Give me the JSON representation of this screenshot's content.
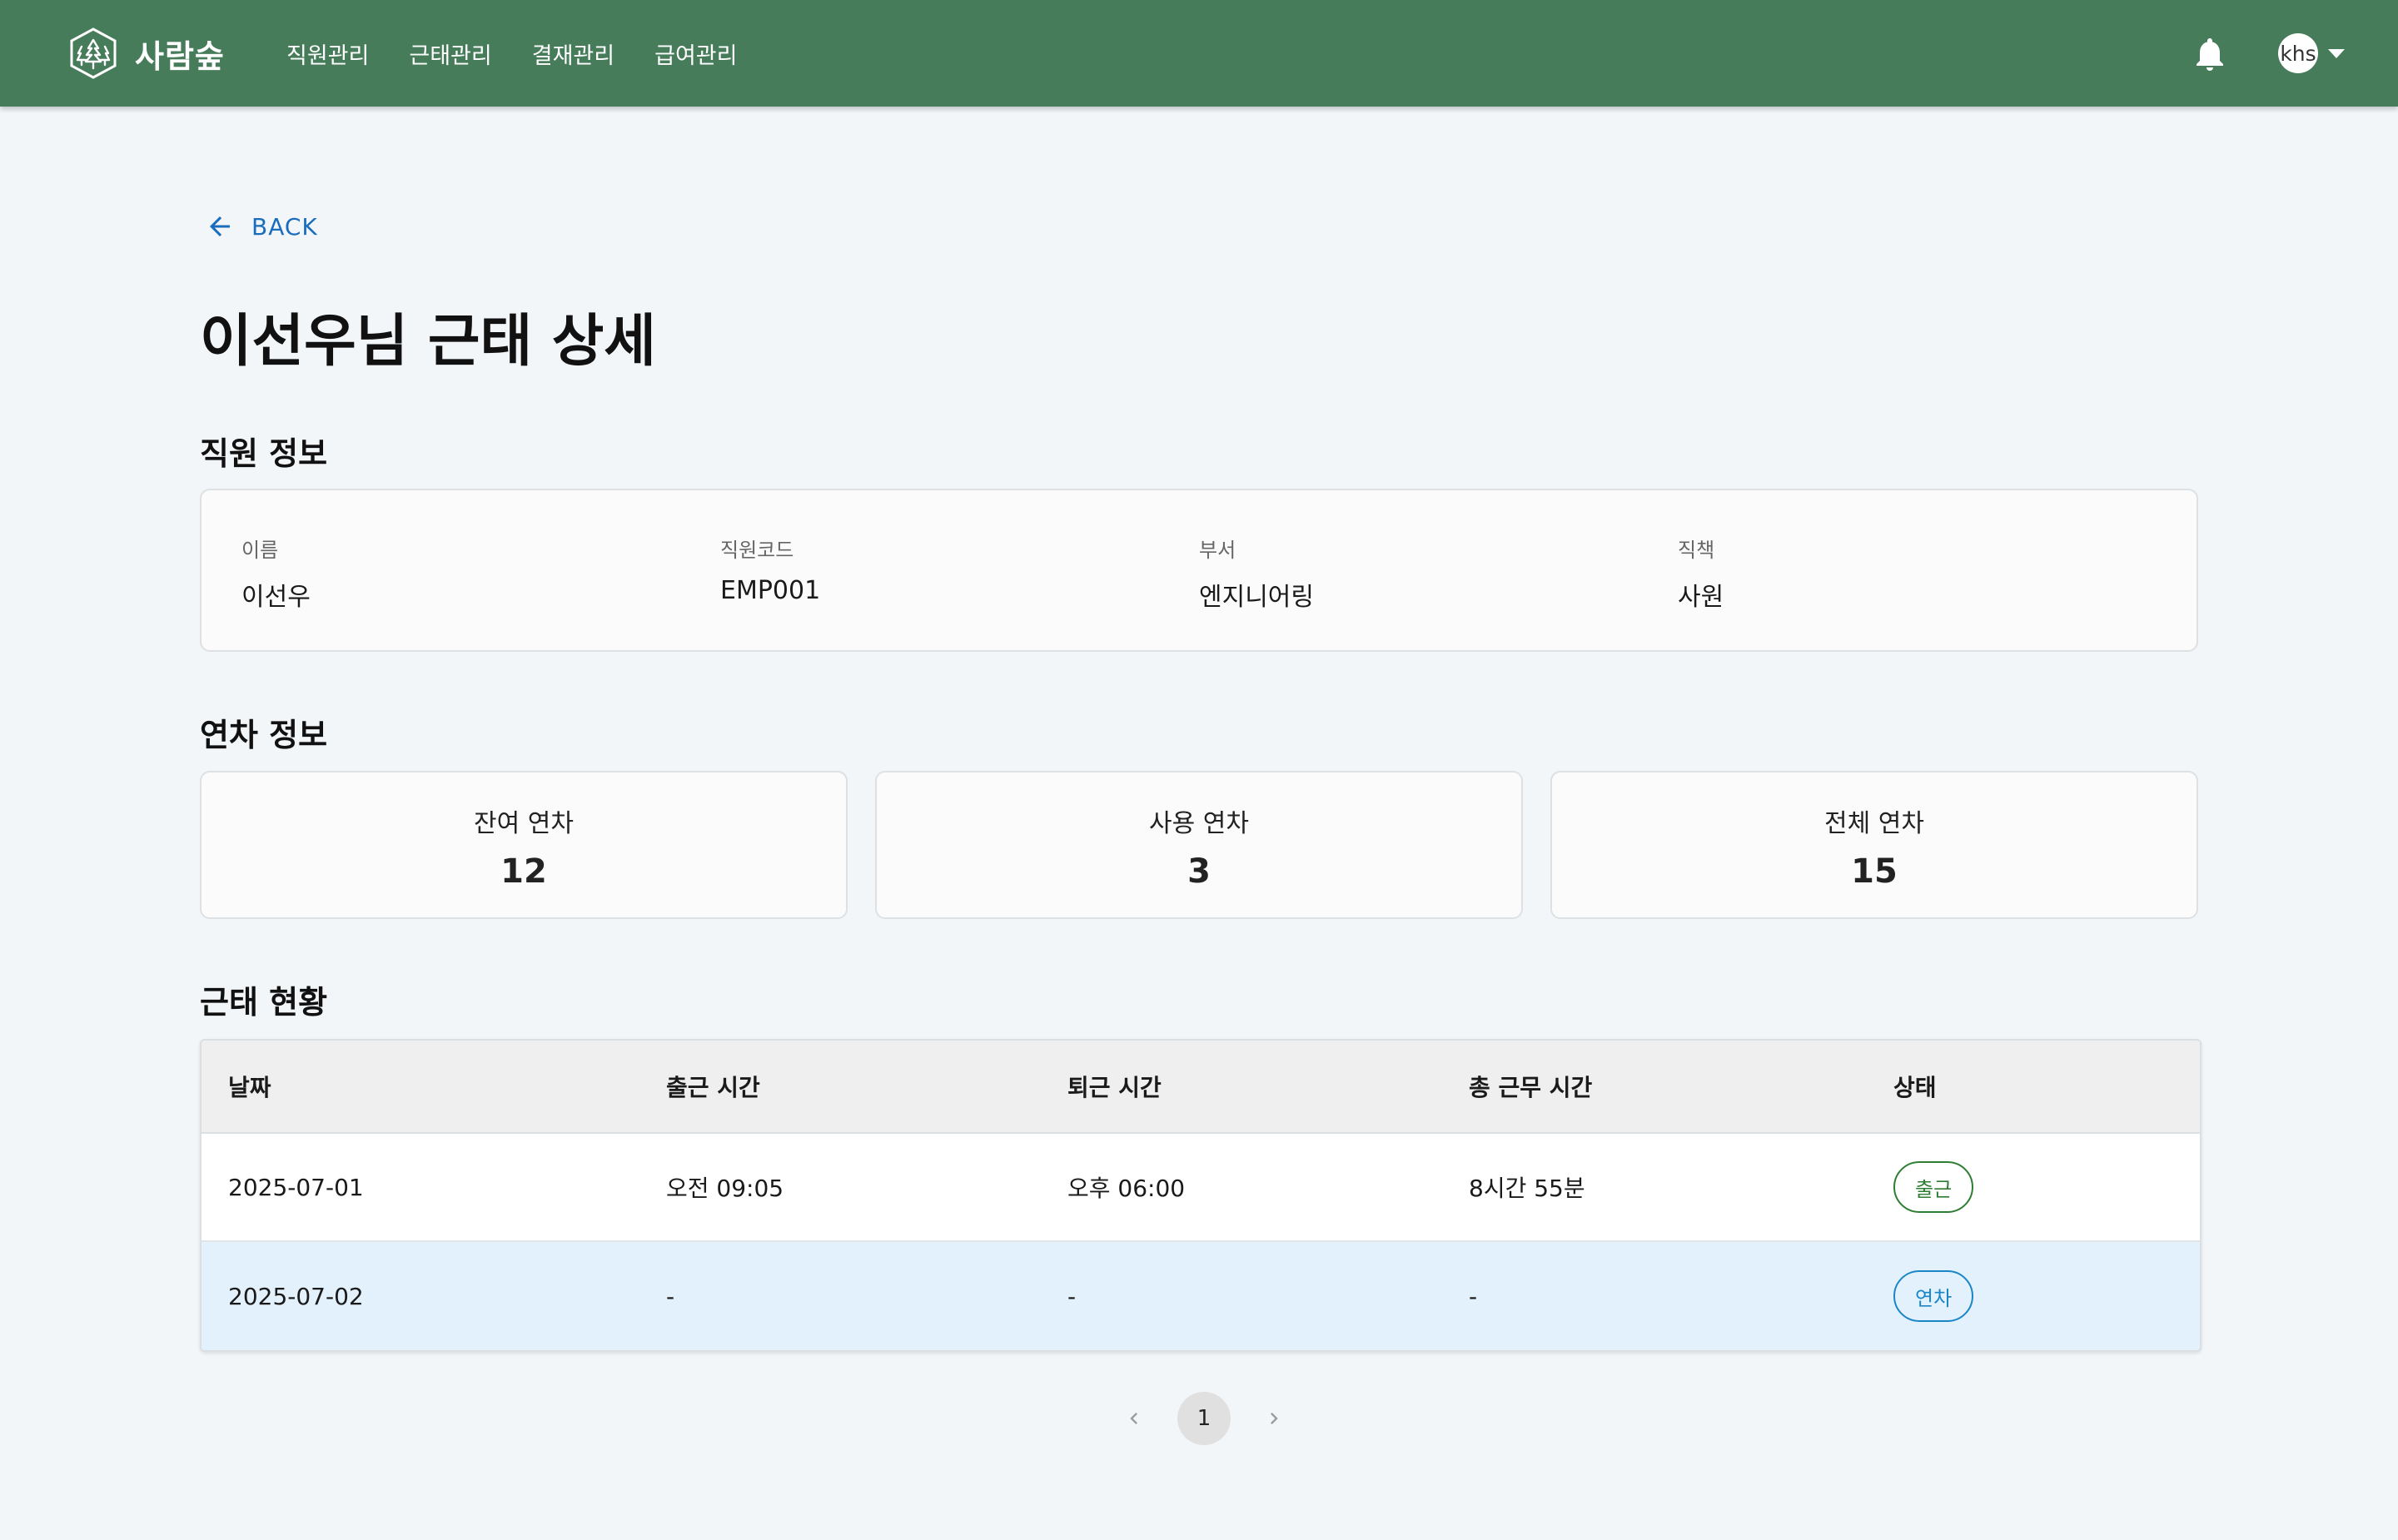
{
  "header": {
    "brand": "사람숲",
    "nav": [
      "직원관리",
      "근태관리",
      "결재관리",
      "급여관리"
    ],
    "user_initials": "khs"
  },
  "back_label": "BACK",
  "page_title": "이선우님 근태 상세",
  "employee_section": {
    "title": "직원 정보",
    "fields": [
      {
        "label": "이름",
        "value": "이선우"
      },
      {
        "label": "직원코드",
        "value": "EMP001"
      },
      {
        "label": "부서",
        "value": "엔지니어링"
      },
      {
        "label": "직책",
        "value": "사원"
      }
    ]
  },
  "leave_section": {
    "title": "연차 정보",
    "cards": [
      {
        "label": "잔여 연차",
        "value": "12"
      },
      {
        "label": "사용 연차",
        "value": "3"
      },
      {
        "label": "전체 연차",
        "value": "15"
      }
    ]
  },
  "attendance_section": {
    "title": "근태 현황",
    "columns": [
      "날짜",
      "출근 시간",
      "퇴근 시간",
      "총 근무 시간",
      "상태"
    ],
    "rows": [
      {
        "date": "2025-07-01",
        "in": "오전 09:05",
        "out": "오후 06:00",
        "total": "8시간 55분",
        "status": "출근"
      },
      {
        "date": "2025-07-02",
        "in": "-",
        "out": "-",
        "total": "-",
        "status": "연차"
      }
    ]
  },
  "pagination": {
    "current_page": "1"
  },
  "colors": {
    "appbar": "#467c5a",
    "link": "#1a6dbd",
    "status_present": "#2e7d32",
    "status_leave": "#1a86c8",
    "highlight_row": "#e3f1fc"
  }
}
